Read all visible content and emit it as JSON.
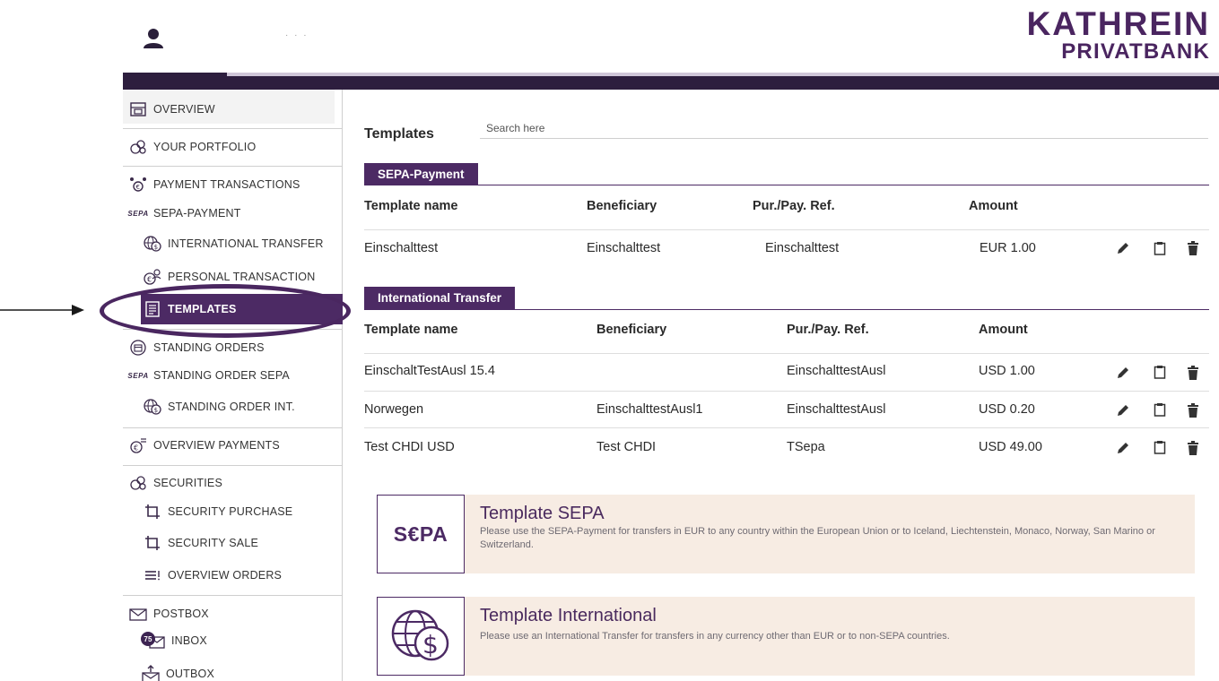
{
  "header": {
    "user_name": "· · ·",
    "logo_line1": "KATHREIN",
    "logo_line2": "PRIVATBANK"
  },
  "sidebar": {
    "overview": "OVERVIEW",
    "portfolio": "YOUR PORTFOLIO",
    "payment_transactions": "PAYMENT TRANSACTIONS",
    "sepa_payment": "SEPA-PAYMENT",
    "international_transfer": "INTERNATIONAL TRANSFER",
    "personal_transaction": "PERSONAL TRANSACTION",
    "templates": "TEMPLATES",
    "standing_orders": "STANDING ORDERS",
    "standing_order_sepa": "STANDING ORDER SEPA",
    "standing_order_int": "STANDING ORDER INT.",
    "overview_payments": "OVERVIEW PAYMENTS",
    "securities": "SECURITIES",
    "security_purchase": "SECURITY PURCHASE",
    "security_sale": "SECURITY SALE",
    "overview_orders": "OVERVIEW ORDERS",
    "postbox": "POSTBOX",
    "inbox": "INBOX",
    "inbox_count": "75",
    "outbox": "OUTBOX",
    "sepa_mini": "SEPA"
  },
  "main": {
    "title": "Templates",
    "search_placeholder": "Search here",
    "sepa": {
      "tab": "SEPA-Payment",
      "headers": [
        "Template name",
        "Beneficiary",
        "Pur./Pay. Ref.",
        "Amount"
      ],
      "rows": [
        {
          "name": "Einschalttest",
          "beneficiary": "Einschalttest",
          "ref": "Einschalttest",
          "amount": "EUR 1.00"
        }
      ]
    },
    "international": {
      "tab": "International Transfer",
      "headers": [
        "Template name",
        "Beneficiary",
        "Pur./Pay. Ref.",
        "Amount"
      ],
      "rows": [
        {
          "name": "EinschaltTestAusl 15.4",
          "beneficiary": "",
          "ref": "EinschalttestAusl",
          "amount": "USD 1.00"
        },
        {
          "name": "Norwegen",
          "beneficiary": "EinschalttestAusl1",
          "ref": "EinschalttestAusl",
          "amount": "USD 0.20"
        },
        {
          "name": "Test CHDI USD",
          "beneficiary": "Test CHDI",
          "ref": "TSepa",
          "amount": "USD 49.00"
        }
      ]
    },
    "info_sepa": {
      "logo": "S€PA",
      "title": "Template SEPA",
      "text": "Please use the SEPA-Payment for transfers in EUR to any country within the European Union or to Iceland, Liechtenstein, Monaco, Norway, San Marino or Switzerland."
    },
    "info_international": {
      "title": "Template International",
      "text": "Please use an International Transfer for transfers in any currency other than EUR or to non-SEPA countries."
    }
  },
  "colors": {
    "brand_purple": "#4c2a64",
    "topbar": "#2d1e3e",
    "info_bg": "#f7ece3"
  }
}
